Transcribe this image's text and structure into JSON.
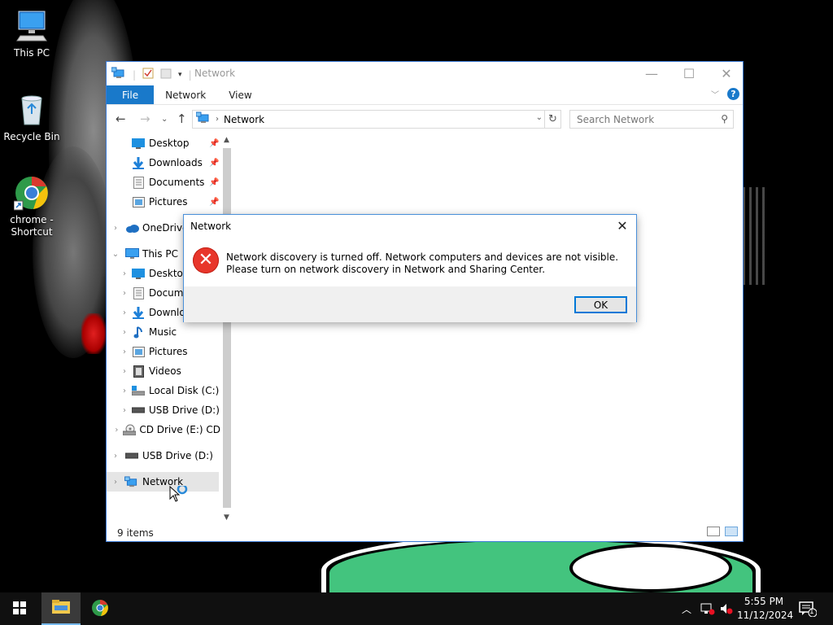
{
  "desktop": {
    "icons": [
      {
        "label": "This PC"
      },
      {
        "label": "Recycle Bin"
      },
      {
        "label": "chrome - Shortcut"
      }
    ]
  },
  "explorer": {
    "title": "Network",
    "ribbon": {
      "file": "File",
      "network": "Network",
      "view": "View"
    },
    "address": {
      "crumb": "Network"
    },
    "search": {
      "placeholder": "Search Network"
    },
    "nav": {
      "quick_access": [
        "Desktop",
        "Downloads",
        "Documents",
        "Pictures"
      ],
      "onedrive": "OneDrive",
      "this_pc": "This PC",
      "this_pc_children": [
        "Desktop",
        "Docume",
        "Downlo",
        "Music",
        "Pictures",
        "Videos",
        "Local Disk (C:)",
        "USB Drive (D:)",
        "CD Drive (E:) CD"
      ],
      "usb": "USB Drive (D:)",
      "network": "Network"
    },
    "status": "9 items"
  },
  "dialog": {
    "title": "Network",
    "message": "Network discovery is turned off. Network computers and devices are not visible. Please turn on network discovery in Network and Sharing Center.",
    "ok": "OK"
  },
  "taskbar": {
    "time": "5:55 PM",
    "date": "11/12/2024",
    "notification_count": "1"
  },
  "colors": {
    "accent": "#1979ca",
    "error": "#e8362b",
    "taskbar": "#101010"
  }
}
